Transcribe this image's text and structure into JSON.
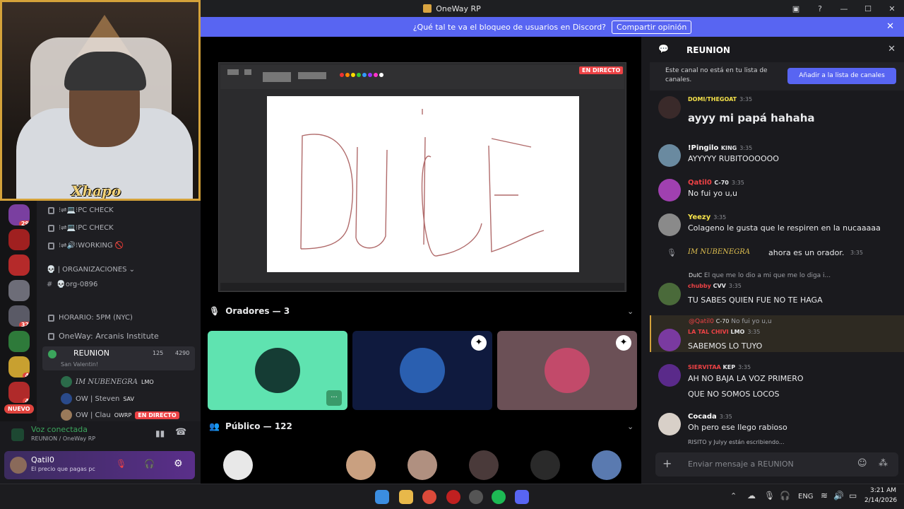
{
  "window": {
    "title": "OneWay RP",
    "minimize": "—",
    "maximize": "☐",
    "close": "✕",
    "help": "?"
  },
  "banner": {
    "text": "¿Qué tal te va el bloqueo de usuarios en Discord?",
    "button": "Compartir opinión",
    "close": "✕"
  },
  "webcam": {
    "overlay_name": "Xhapo"
  },
  "rail": {
    "badges": [
      "29",
      "32",
      "4",
      "4"
    ],
    "new_label": "NUEVO"
  },
  "channels": {
    "items": [
      {
        "text": "⁝⇌💻⁝PC CHECK"
      },
      {
        "text": "⁝⇌💻⁝PC CHECK"
      },
      {
        "text": "⁝⇌🔊⁝WORKING 🚫"
      },
      {
        "text": "💀 | ORGANIZACIONES ⌄"
      },
      {
        "text": "💀org-0896"
      },
      {
        "text": "HORARIO: 5PM (NYC)"
      },
      {
        "text": "OneWay: Arcanis Institute"
      }
    ],
    "active_voice": {
      "name": "REUNION",
      "count": "125",
      "limit": "4290",
      "subtitle": "San Valentin!"
    },
    "voice_users": [
      {
        "name": "IM NUBENEGRA",
        "tag": "LMO"
      },
      {
        "name": "OW | Steven",
        "tag": "SAV"
      },
      {
        "name": "OW | Clau",
        "tag": "OWRP",
        "live": "EN DIRECTO"
      }
    ]
  },
  "voice_status": {
    "title": "Voz conectada",
    "location": "REUNION / OneWay RP"
  },
  "user": {
    "name": "Qatil0",
    "status": "El precio que pagas pc"
  },
  "stage": {
    "live_label": "EN DIRECTO",
    "canvas_text": "DUICE",
    "speakers_title": "Oradores — 3",
    "audience_title": "Público — 122",
    "tile_more": "···"
  },
  "chat": {
    "channel": "REUNION",
    "notice": "Este canal no está en tu lista de canales.",
    "add_button": "Añadir a la lista de canales",
    "messages": [
      {
        "author": "DOMI/THEGOAT",
        "time": "3:35",
        "text": "ayyy mi papá hahaha"
      },
      {
        "author": "!Pingilo",
        "tag": "KING",
        "time": "3:35",
        "text": "AYYYYY RUBITOOOOOO"
      },
      {
        "author": "Qatil0",
        "tag": "C-70",
        "time": "3:35",
        "text": "No fui yo u,u"
      },
      {
        "author": "Yeezy",
        "time": "3:35",
        "text": "Colageno le gusta que le respiren en la nucaaaaa"
      },
      {
        "system": "IM NUBENEGRA",
        "system_text": "ahora es un orador.",
        "time": "3:35"
      },
      {
        "reply": "El que me lo dio a mi que me lo diga i...",
        "reply_tag": "DulC",
        "author": "chubby",
        "tag": "CVV",
        "time": "3:35",
        "text": "TU SABES QUIEN FUE NO TE HAGA"
      },
      {
        "reply": "No fui yo u,u",
        "reply_author": "@Qatil0",
        "reply_tag": "C-70",
        "author": "LA TAL CHIVI",
        "tag": "LMO",
        "time": "3:35",
        "text": "SABEMOS LO TUYO"
      },
      {
        "author": "SIERVITAA",
        "tag": "KEP",
        "time": "3:35",
        "text": "AH NO BAJA LA VOZ PRIMERO",
        "text2": "QUE NO SOMOS LOCOS"
      },
      {
        "author": "Cocada",
        "time": "3:35",
        "text": "Oh pero ese llego rabioso"
      }
    ],
    "typing": "RISITO y Julyy están escribiendo...",
    "composer_placeholder": "Enviar mensaje a REUNION"
  },
  "taskbar": {
    "lang": "ENG",
    "time": "3:21 AM",
    "date": "2/14/2026"
  },
  "colors": {
    "accent": "#5865f2",
    "live": "#ed4245",
    "speaking_tile": "#5fe3b0",
    "webcam_border": "#d4a23a"
  }
}
